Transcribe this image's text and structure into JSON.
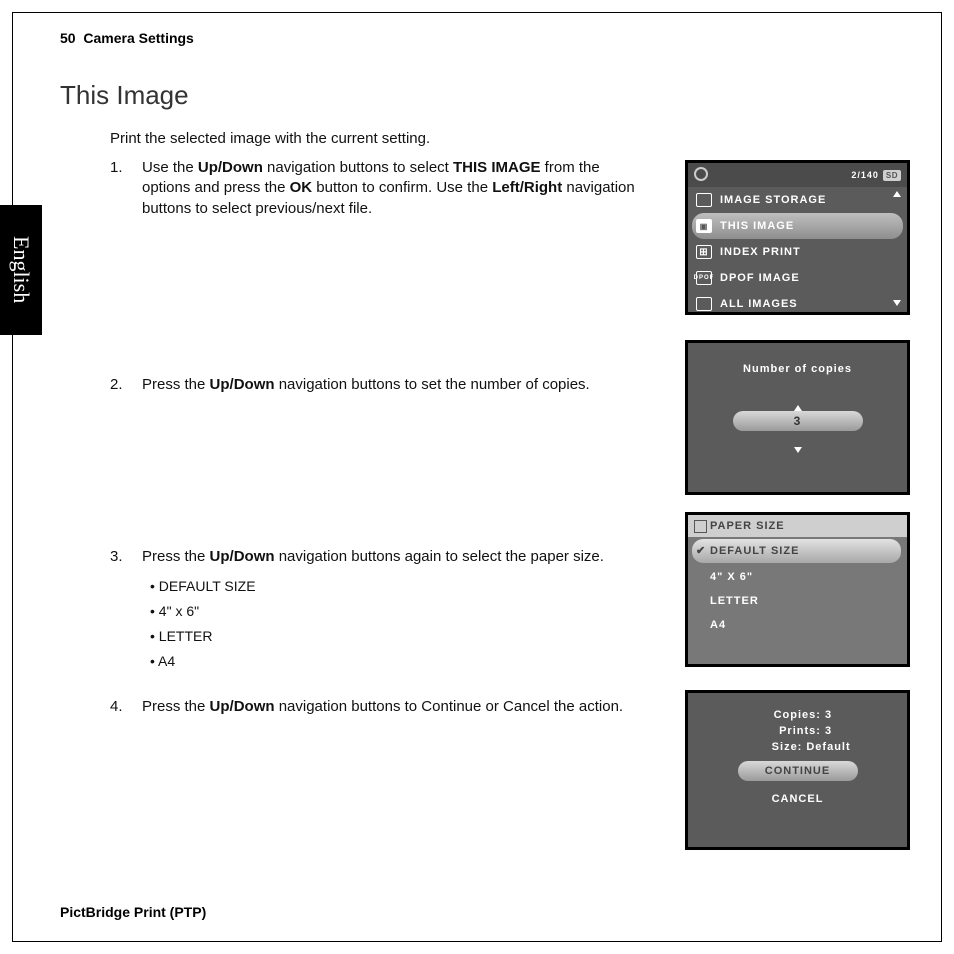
{
  "header": {
    "page_num": "50",
    "section": "Camera Settings"
  },
  "title": "This Image",
  "intro": "Print the selected image with the current setting.",
  "lang_tab": "English",
  "steps": {
    "s1": {
      "num": "1.",
      "text_pre": "Use the ",
      "b1": "Up/Down",
      "t2": " navigation buttons to select ",
      "b2": "THIS IMAGE",
      "t3": " from the options and press the ",
      "b3": "OK",
      "t4": " button to confirm. Use the ",
      "b4": "Left/Right",
      "t5": " navigation buttons to select previous/next file."
    },
    "s2": {
      "num": "2.",
      "pre": "Press the ",
      "b": "Up/Down",
      "post": " navigation buttons to set the number of copies."
    },
    "s3": {
      "num": "3.",
      "pre": "Press the ",
      "b": "Up/Down",
      "post": " navigation buttons again to select the paper size.",
      "bullets": [
        "DEFAULT SIZE",
        "4\" x 6\"",
        "LETTER",
        "A4"
      ]
    },
    "s4": {
      "num": "4.",
      "pre": "Press the ",
      "b": "Up/Down",
      "post": " navigation buttons to Continue or Cancel the action."
    }
  },
  "footer": "PictBridge Print (PTP)",
  "screen1": {
    "counter": "2/140",
    "sd": "SD",
    "items": [
      "IMAGE STORAGE",
      "THIS IMAGE",
      "INDEX PRINT",
      "DPOF IMAGE",
      "ALL IMAGES"
    ]
  },
  "screen2": {
    "title": "Number of copies",
    "value": "3"
  },
  "screen3": {
    "header": "PAPER SIZE",
    "items": [
      "DEFAULT SIZE",
      "4\" X 6\"",
      "LETTER",
      "A4"
    ]
  },
  "screen4": {
    "lines": [
      {
        "k": "Copies:",
        "v": "3"
      },
      {
        "k": "Prints:",
        "v": "3"
      },
      {
        "k": "Size:",
        "v": "Default"
      }
    ],
    "continue": "CONTINUE",
    "cancel": "CANCEL"
  }
}
